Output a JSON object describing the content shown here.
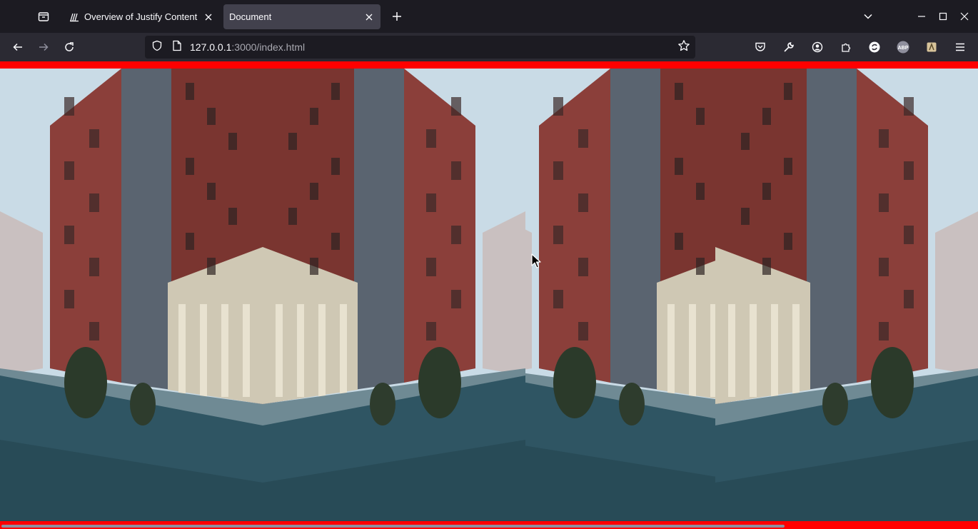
{
  "window": {
    "tabs": [
      {
        "title": "Overview of Justify Content",
        "favicon": "css-tricks-icon",
        "active": false
      },
      {
        "title": "Document",
        "favicon": "",
        "active": true
      }
    ],
    "new_tab_icon": "plus-icon",
    "controls": [
      "tab-list-icon",
      "minimize-icon",
      "maximize-icon",
      "close-icon"
    ]
  },
  "navbar": {
    "url_host": "127.0.0.1",
    "url_path": ":3000/index.html",
    "icons": [
      "pocket-icon",
      "wrench-icon",
      "account-icon",
      "extensions-icon",
      "sync-icon",
      "adblock-icon",
      "extension-icon",
      "menu-icon"
    ]
  },
  "page": {
    "background_color": "#ff0000",
    "images": [
      {
        "alt": "street photo",
        "mirrored": false
      },
      {
        "alt": "street photo",
        "mirrored": true
      },
      {
        "alt": "street photo",
        "mirrored": false
      },
      {
        "alt": "street photo",
        "mirrored": true
      }
    ]
  }
}
